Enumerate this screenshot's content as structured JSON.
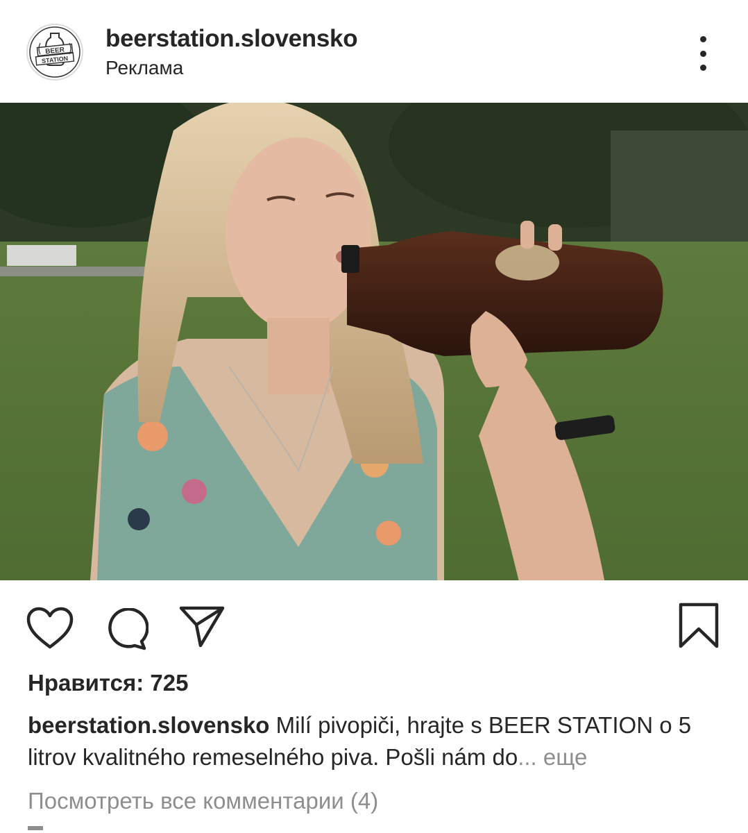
{
  "header": {
    "username": "beerstation.slovensko",
    "sponsored_label": "Реклама",
    "avatar_logo_text": [
      "BEER",
      "STATION"
    ]
  },
  "post": {
    "image_alt": "",
    "likes_label": "Нравится: 725",
    "caption_username": "beerstation.slovensko",
    "caption_text": " Milí pivopiči, hrajte s BEER STATION o 5 litrov kvalitného remeselného piva. Pošli nám do",
    "caption_ellipsis": "...",
    "caption_more": " еще",
    "view_comments": "Посмотреть все комментарии (4)"
  },
  "icons": {
    "like": "heart-icon",
    "comment": "comment-bubble-icon",
    "share": "paper-plane-icon",
    "save": "bookmark-icon",
    "options": "more-vertical-icon"
  },
  "colors": {
    "text": "#262626",
    "secondary": "#8e8e8e",
    "background": "#ffffff"
  }
}
